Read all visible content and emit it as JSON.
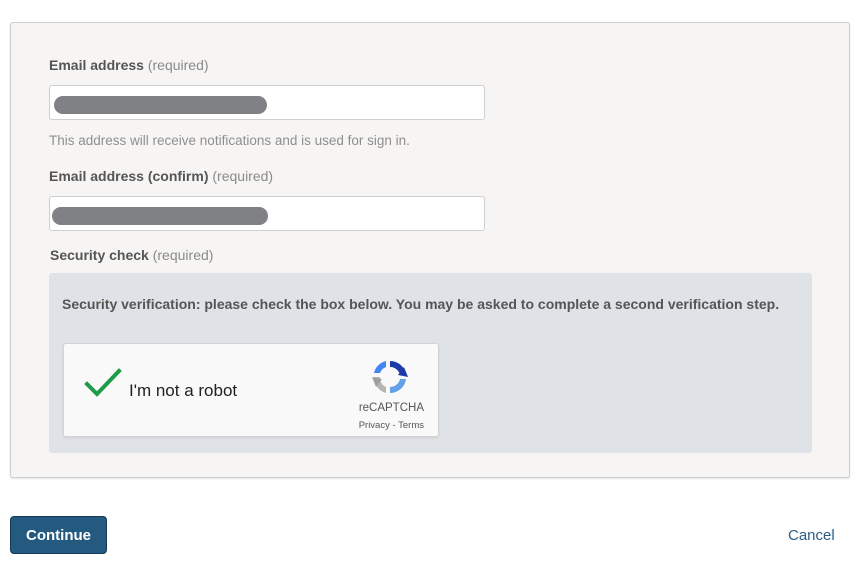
{
  "email": {
    "label": "Email address",
    "required": "(required)",
    "hint": "This address will receive notifications and is used for sign in."
  },
  "email_confirm": {
    "label": "Email address (confirm)",
    "required": "(required)"
  },
  "security": {
    "label": "Security check",
    "required": "(required)",
    "message": "Security verification: please check the box below. You may be asked to complete a second verification step."
  },
  "captcha": {
    "label": "I'm not a robot",
    "brand": "reCAPTCHA",
    "privacy": "Privacy",
    "separator": " - ",
    "terms": "Terms",
    "checked": true
  },
  "actions": {
    "continue_label": "Continue",
    "cancel_label": "Cancel"
  },
  "colors": {
    "primary_button": "#245a80",
    "link": "#2a5d86",
    "check": "#1e9c4a"
  },
  "icons": {
    "check": "checkmark-icon",
    "recaptcha": "recaptcha-logo-icon"
  }
}
